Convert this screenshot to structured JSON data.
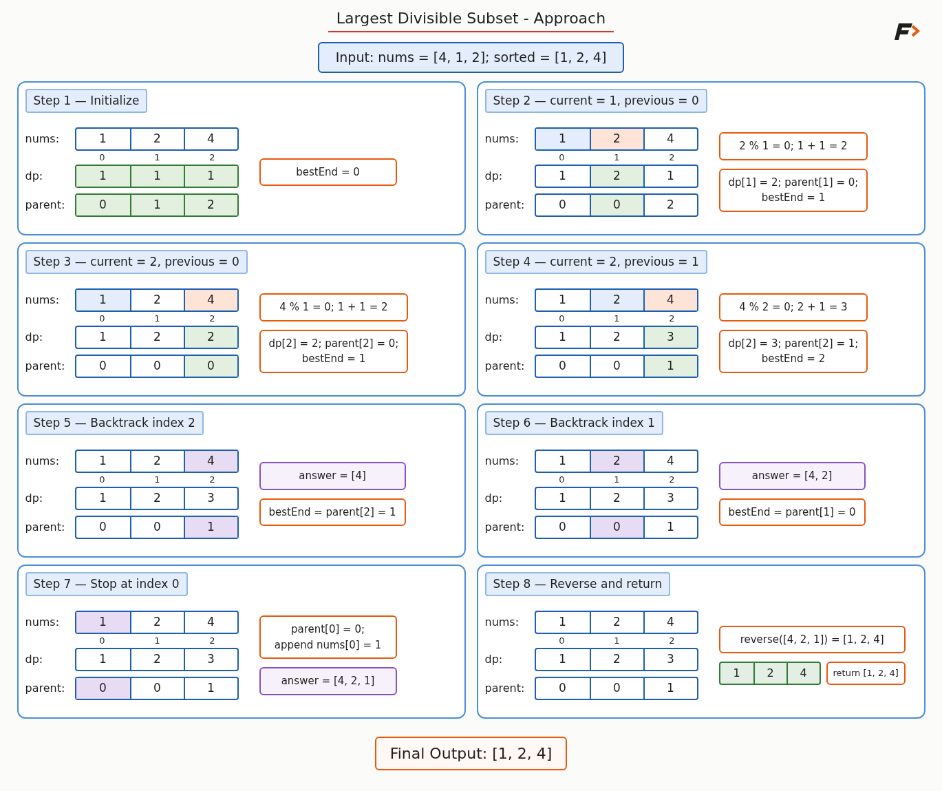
{
  "title": "Largest Divisible Subset - Approach",
  "input": "Input: nums = [4, 1, 2]; sorted = [1, 2, 4]",
  "steps": [
    {
      "title": "Step 1 — Initialize",
      "rows": [
        {
          "label": "nums:",
          "color": "#1c5fb0",
          "cells": [
            {
              "value": "1"
            },
            {
              "value": "2"
            },
            {
              "value": "4"
            }
          ]
        },
        {
          "kind": "index",
          "cells": [
            {
              "value": "0"
            },
            {
              "value": "1"
            },
            {
              "value": "2"
            }
          ]
        },
        {
          "label": "dp:",
          "color": "#2f7d32",
          "cells": [
            {
              "value": "1",
              "color": "#e3f0df"
            },
            {
              "value": "1",
              "color": "#e3f0df"
            },
            {
              "value": "1",
              "color": "#e3f0df"
            }
          ]
        },
        {
          "label": "parent:",
          "color": "#2f7d32",
          "cells": [
            {
              "value": "0",
              "color": "#e3f0df"
            },
            {
              "value": "1",
              "color": "#e3f0df"
            },
            {
              "value": "2",
              "color": "#e3f0df"
            }
          ]
        }
      ],
      "notes": [
        {
          "kind": "note",
          "color": "#e8590c",
          "shaded": false,
          "lines": [
            "bestEnd = 0"
          ]
        }
      ]
    },
    {
      "title": "Step 2 — current = 1, previous = 0",
      "rows": [
        {
          "label": "nums:",
          "color": "#1c5fb0",
          "cells": [
            {
              "value": "1",
              "color": "#e3edfb"
            },
            {
              "value": "2",
              "color": "#fde4d6"
            },
            {
              "value": "4"
            }
          ]
        },
        {
          "kind": "index",
          "cells": [
            {
              "value": "0"
            },
            {
              "value": "1"
            },
            {
              "value": "2"
            }
          ]
        },
        {
          "label": "dp:",
          "color": "#1c5fb0",
          "cells": [
            {
              "value": "1"
            },
            {
              "value": "2",
              "color": "#e3f0df"
            },
            {
              "value": "1"
            }
          ]
        },
        {
          "label": "parent:",
          "color": "#1c5fb0",
          "cells": [
            {
              "value": "0"
            },
            {
              "value": "0",
              "color": "#e3f0df"
            },
            {
              "value": "2"
            }
          ]
        }
      ],
      "notes": [
        {
          "kind": "note",
          "color": "#e8590c",
          "shaded": false,
          "lines": [
            "2 % 1 = 0; 1 + 1 = 2"
          ]
        },
        {
          "kind": "note",
          "color": "#e8590c",
          "shaded": false,
          "lines": [
            "dp[1] = 2; parent[1] = 0;",
            "bestEnd = 1"
          ]
        }
      ]
    },
    {
      "title": "Step 3 — current = 2, previous = 0",
      "rows": [
        {
          "label": "nums:",
          "color": "#1c5fb0",
          "cells": [
            {
              "value": "1",
              "color": "#e3edfb"
            },
            {
              "value": "2"
            },
            {
              "value": "4",
              "color": "#fde4d6"
            }
          ]
        },
        {
          "kind": "index",
          "cells": [
            {
              "value": "0"
            },
            {
              "value": "1"
            },
            {
              "value": "2"
            }
          ]
        },
        {
          "label": "dp:",
          "color": "#1c5fb0",
          "cells": [
            {
              "value": "1"
            },
            {
              "value": "2"
            },
            {
              "value": "2",
              "color": "#e3f0df"
            }
          ]
        },
        {
          "label": "parent:",
          "color": "#1c5fb0",
          "cells": [
            {
              "value": "0"
            },
            {
              "value": "0"
            },
            {
              "value": "0",
              "color": "#e3f0df"
            }
          ]
        }
      ],
      "notes": [
        {
          "kind": "note",
          "color": "#e8590c",
          "shaded": false,
          "lines": [
            "4 % 1 = 0; 1 + 1 = 2"
          ]
        },
        {
          "kind": "note",
          "color": "#e8590c",
          "shaded": false,
          "lines": [
            "dp[2] = 2; parent[2] = 0;",
            "bestEnd = 1"
          ]
        }
      ]
    },
    {
      "title": "Step 4 — current = 2, previous = 1",
      "rows": [
        {
          "label": "nums:",
          "color": "#1c5fb0",
          "cells": [
            {
              "value": "1"
            },
            {
              "value": "2",
              "color": "#e3edfb"
            },
            {
              "value": "4",
              "color": "#fde4d6"
            }
          ]
        },
        {
          "kind": "index",
          "cells": [
            {
              "value": "0"
            },
            {
              "value": "1"
            },
            {
              "value": "2"
            }
          ]
        },
        {
          "label": "dp:",
          "color": "#1c5fb0",
          "cells": [
            {
              "value": "1"
            },
            {
              "value": "2"
            },
            {
              "value": "3",
              "color": "#e3f0df"
            }
          ]
        },
        {
          "label": "parent:",
          "color": "#1c5fb0",
          "cells": [
            {
              "value": "0"
            },
            {
              "value": "0"
            },
            {
              "value": "1",
              "color": "#e3f0df"
            }
          ]
        }
      ],
      "notes": [
        {
          "kind": "note",
          "color": "#e8590c",
          "shaded": false,
          "lines": [
            "4 % 2 = 0; 2 + 1 = 3"
          ]
        },
        {
          "kind": "note",
          "color": "#e8590c",
          "shaded": false,
          "lines": [
            "dp[2] = 3; parent[2] = 1;",
            "bestEnd = 2"
          ]
        }
      ]
    },
    {
      "title": "Step 5 — Backtrack index 2",
      "rows": [
        {
          "label": "nums:",
          "color": "#1c5fb0",
          "cells": [
            {
              "value": "1"
            },
            {
              "value": "2"
            },
            {
              "value": "4",
              "color": "#e8dcf5"
            }
          ]
        },
        {
          "kind": "index",
          "cells": [
            {
              "value": "0"
            },
            {
              "value": "1"
            },
            {
              "value": "2"
            }
          ]
        },
        {
          "label": "dp:",
          "color": "#1c5fb0",
          "cells": [
            {
              "value": "1"
            },
            {
              "value": "2"
            },
            {
              "value": "3"
            }
          ]
        },
        {
          "label": "parent:",
          "color": "#1c5fb0",
          "cells": [
            {
              "value": "0"
            },
            {
              "value": "0"
            },
            {
              "value": "1",
              "color": "#e8dcf5"
            }
          ]
        }
      ],
      "notes": [
        {
          "kind": "note",
          "color": "#8652c4",
          "shaded": true,
          "lines": [
            "answer = [4]"
          ]
        },
        {
          "kind": "note",
          "color": "#e8590c",
          "shaded": false,
          "lines": [
            "bestEnd = parent[2] = 1"
          ]
        }
      ]
    },
    {
      "title": "Step 6 — Backtrack index 1",
      "rows": [
        {
          "label": "nums:",
          "color": "#1c5fb0",
          "cells": [
            {
              "value": "1"
            },
            {
              "value": "2",
              "color": "#e8dcf5"
            },
            {
              "value": "4"
            }
          ]
        },
        {
          "kind": "index",
          "cells": [
            {
              "value": "0"
            },
            {
              "value": "1"
            },
            {
              "value": "2"
            }
          ]
        },
        {
          "label": "dp:",
          "color": "#1c5fb0",
          "cells": [
            {
              "value": "1"
            },
            {
              "value": "2"
            },
            {
              "value": "3"
            }
          ]
        },
        {
          "label": "parent:",
          "color": "#1c5fb0",
          "cells": [
            {
              "value": "0"
            },
            {
              "value": "0",
              "color": "#e8dcf5"
            },
            {
              "value": "1"
            }
          ]
        }
      ],
      "notes": [
        {
          "kind": "note",
          "color": "#8652c4",
          "shaded": true,
          "lines": [
            "answer = [4, 2]"
          ]
        },
        {
          "kind": "note",
          "color": "#e8590c",
          "shaded": false,
          "lines": [
            "bestEnd = parent[1] = 0"
          ]
        }
      ]
    },
    {
      "title": "Step 7 — Stop at index 0",
      "rows": [
        {
          "label": "nums:",
          "color": "#1c5fb0",
          "cells": [
            {
              "value": "1",
              "color": "#e8dcf5"
            },
            {
              "value": "2"
            },
            {
              "value": "4"
            }
          ]
        },
        {
          "kind": "index",
          "cells": [
            {
              "value": "0"
            },
            {
              "value": "1"
            },
            {
              "value": "2"
            }
          ]
        },
        {
          "label": "dp:",
          "color": "#1c5fb0",
          "cells": [
            {
              "value": "1"
            },
            {
              "value": "2"
            },
            {
              "value": "3"
            }
          ]
        },
        {
          "label": "parent:",
          "color": "#1c5fb0",
          "cells": [
            {
              "value": "0",
              "color": "#e8dcf5"
            },
            {
              "value": "0"
            },
            {
              "value": "1"
            }
          ]
        }
      ],
      "notes": [
        {
          "kind": "note",
          "color": "#e8590c",
          "shaded": false,
          "lines": [
            "parent[0] = 0;",
            "append nums[0] = 1"
          ]
        },
        {
          "kind": "note",
          "color": "#8652c4",
          "shaded": true,
          "lines": [
            "answer = [4, 2, 1]"
          ]
        }
      ]
    },
    {
      "title": "Step 8 — Reverse and return",
      "rows": [
        {
          "label": "nums:",
          "color": "#1c5fb0",
          "cells": [
            {
              "value": "1"
            },
            {
              "value": "2"
            },
            {
              "value": "4"
            }
          ]
        },
        {
          "kind": "index",
          "cells": [
            {
              "value": "0"
            },
            {
              "value": "1"
            },
            {
              "value": "2"
            }
          ]
        },
        {
          "label": "dp:",
          "color": "#1c5fb0",
          "cells": [
            {
              "value": "1"
            },
            {
              "value": "2"
            },
            {
              "value": "3"
            }
          ]
        },
        {
          "label": "parent:",
          "color": "#1c5fb0",
          "cells": [
            {
              "value": "0"
            },
            {
              "value": "0"
            },
            {
              "value": "1"
            }
          ]
        }
      ],
      "notes": [
        {
          "kind": "note",
          "color": "#e8590c",
          "shaded": false,
          "lines": [
            "reverse([4, 2, 1]) = [1, 2, 4]"
          ]
        },
        {
          "kind": "result",
          "color": "#2f7d32",
          "cells": [
            "1",
            "2",
            "4"
          ],
          "ret": {
            "color": "#e8590c",
            "text": "return [1, 2, 4]"
          }
        }
      ]
    }
  ],
  "final": "Final Output: [1, 2, 4]"
}
